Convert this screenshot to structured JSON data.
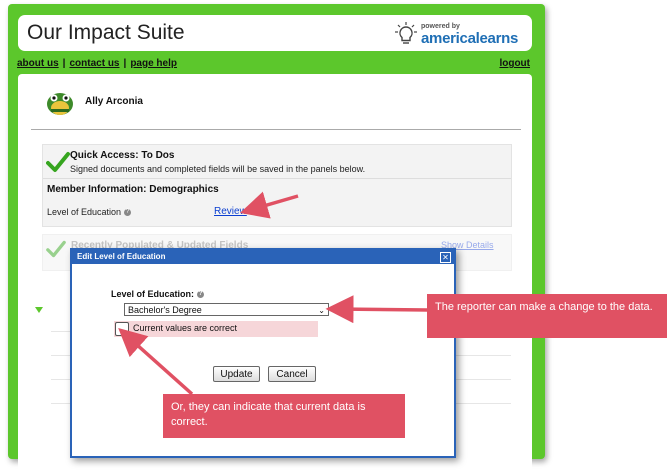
{
  "app": {
    "title": "Our Impact Suite"
  },
  "logo": {
    "small_text": "powered by",
    "brand_text": "americalearns"
  },
  "nav": {
    "links": [
      "about us",
      "contact us",
      "page help"
    ],
    "logout": "logout"
  },
  "user": {
    "name": "Ally Arconia"
  },
  "quick_access": {
    "title": "Quick Access: To Dos",
    "subtitle": "Signed documents and completed fields will be saved in the panels below.",
    "member_info": "Member Information: Demographics",
    "education_label": "Level of Education",
    "review_link": "Review"
  },
  "recent_panel": {
    "title": "Recently Populated & Updated Fields",
    "link": "Show Details"
  },
  "modal": {
    "title": "Edit Level of Education",
    "field_label": "Level of Education:",
    "selected_value": "Bachelor's Degree",
    "checkbox_label": "Current values are correct",
    "checkbox_checked": false,
    "update_label": "Update",
    "cancel_label": "Cancel",
    "close_glyph": "✕"
  },
  "callouts": {
    "change": "The reporter can make a change to the data.",
    "correct": "Or, they can indicate that current data is correct."
  },
  "colors": {
    "shell": "#5cc72c",
    "modal_bar": "#2a63b8",
    "callout": "#e05163",
    "arrow": "#e05163"
  }
}
